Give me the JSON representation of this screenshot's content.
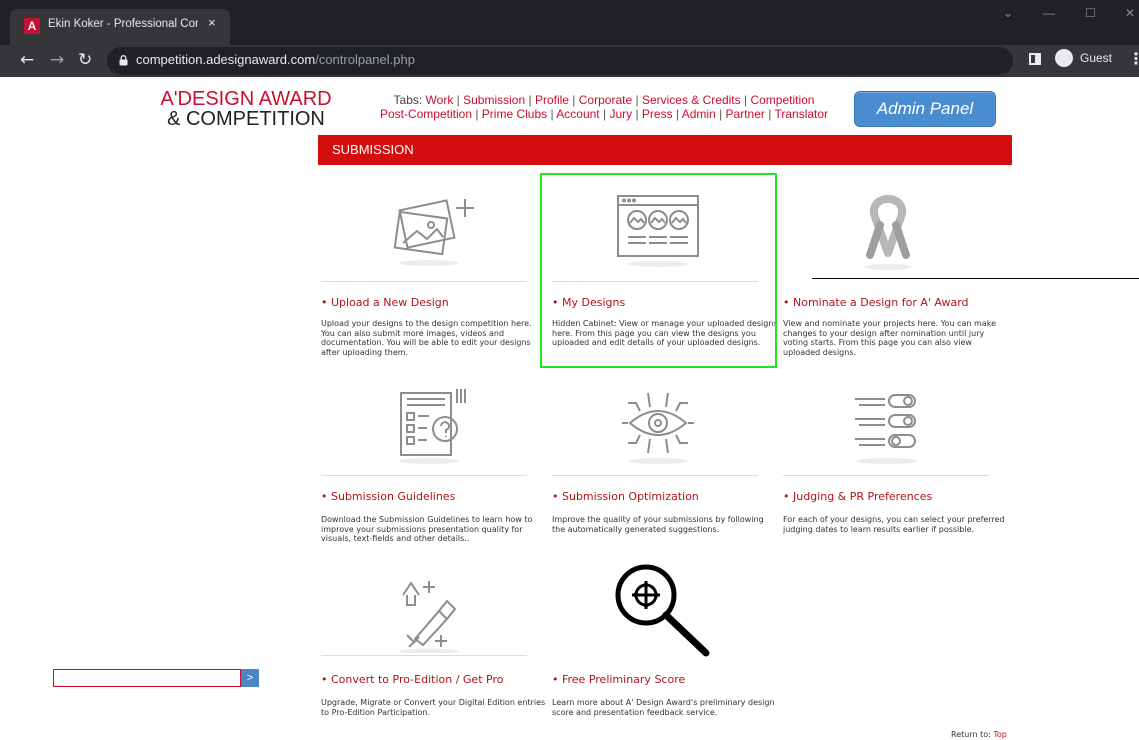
{
  "browser": {
    "tab_title": "Ekin Koker - Professional Contro",
    "tab_close": "×",
    "win_minimize": "—",
    "win_maximize": "☐",
    "win_close": "✕",
    "url_host": "competition.adesignaward.com",
    "url_path": "/controlpanel.php",
    "profile_label": "Guest"
  },
  "logo": {
    "line1": "A'DESIGN AWARD",
    "line2": "& COMPETITION"
  },
  "nav": {
    "prefix": "Tabs:",
    "row1": [
      "Work",
      "Submission",
      "Profile",
      "Corporate",
      "Services & Credits",
      "Competition"
    ],
    "row2": [
      "Post-Competition",
      "Prime Clubs",
      "Account",
      "Jury",
      "Press",
      "Admin",
      "Partner",
      "Translator"
    ]
  },
  "admin_button": "Admin Panel",
  "section_title": "SUBMISSION",
  "cards": [
    {
      "title": "• Upload a New Design",
      "icon": "image-plus-icon",
      "desc": "Upload your designs to the design competition here. You can also submit more images, videos and documentation. You will be able to edit your designs after uploading them."
    },
    {
      "title": "• My Designs",
      "icon": "designs-gallery-icon",
      "desc": "Hidden Cabinet: View or manage your uploaded designs here. From this page you can view the designs you uploaded and edit details of your uploaded designs."
    },
    {
      "title": "• Nominate a Design for A' Award",
      "icon": "ribbon-icon",
      "desc": "View and nominate your projects here. You can make changes to your design after nomination until jury voting starts. From this page you can also view uploaded designs."
    },
    {
      "title": "• Submission Guidelines",
      "icon": "guidelines-icon",
      "desc": "Download the Submission Guidelines to learn how to improve your submissions presentation quality for visuals, text-fields and other details.."
    },
    {
      "title": "• Submission Optimization",
      "icon": "eye-circuit-icon",
      "desc": "Improve the quality of your submissions by following the automatically generated suggestions."
    },
    {
      "title": "• Judging & PR Preferences",
      "icon": "toggles-icon",
      "desc": "For each of your designs, you can select your preferred judging dates to learn results earlier if possible."
    },
    {
      "title": "• Convert to Pro-Edition / Get Pro",
      "icon": "upgrade-icon",
      "desc": "Upgrade, Migrate or Convert your Digital Edition entries to Pro-Edition Participation."
    },
    {
      "title": "• Free Preliminary Score",
      "icon": "magnifier-icon",
      "desc": "Learn more about A' Design Award's preliminary design score and presentation feedback service."
    }
  ],
  "search_button": ">",
  "return_to": {
    "label": "Return to:",
    "link": "Top"
  }
}
